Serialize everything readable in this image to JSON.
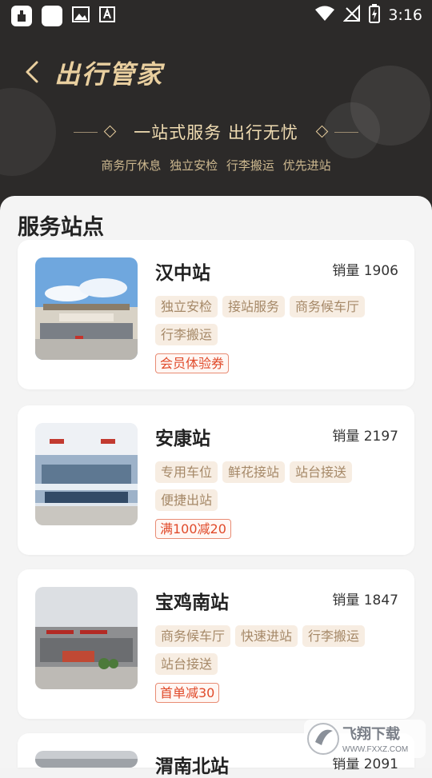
{
  "status_bar": {
    "time": "3:16",
    "left_icons": [
      "app-icon",
      "white-square-icon",
      "image-icon",
      "text-a-icon"
    ],
    "right_icons": [
      "wifi-icon",
      "no-signal-icon",
      "battery-charging-icon"
    ]
  },
  "header": {
    "title": "出行管家",
    "slogan": "一站式服务 出行无忧",
    "features": "商务厅休息  独立安检  行李搬运  优先进站"
  },
  "section": {
    "title": "服务站点"
  },
  "stations": [
    {
      "name": "汉中站",
      "sales": "销量 1906",
      "tags": [
        "独立安检",
        "接站服务",
        "商务候车厅",
        "行李搬运"
      ],
      "promo": "会员体验券"
    },
    {
      "name": "安康站",
      "sales": "销量 2197",
      "tags": [
        "专用车位",
        "鲜花接站",
        "站台接送",
        "便捷出站"
      ],
      "promo": "满100减20"
    },
    {
      "name": "宝鸡南站",
      "sales": "销量 1847",
      "tags": [
        "商务候车厅",
        "快速进站",
        "行李搬运",
        "站台接送"
      ],
      "promo": "首单减30"
    },
    {
      "name": "渭南北站",
      "sales": "销量 2091"
    }
  ],
  "watermark": {
    "brand": "飞翔下载",
    "url": "WWW.FXXZ.COM"
  },
  "colors": {
    "header_bg": "#2c2a29",
    "gold": "#e9cf9f",
    "tag_bg": "#f7ede2",
    "promo_red": "#e04a2a"
  }
}
